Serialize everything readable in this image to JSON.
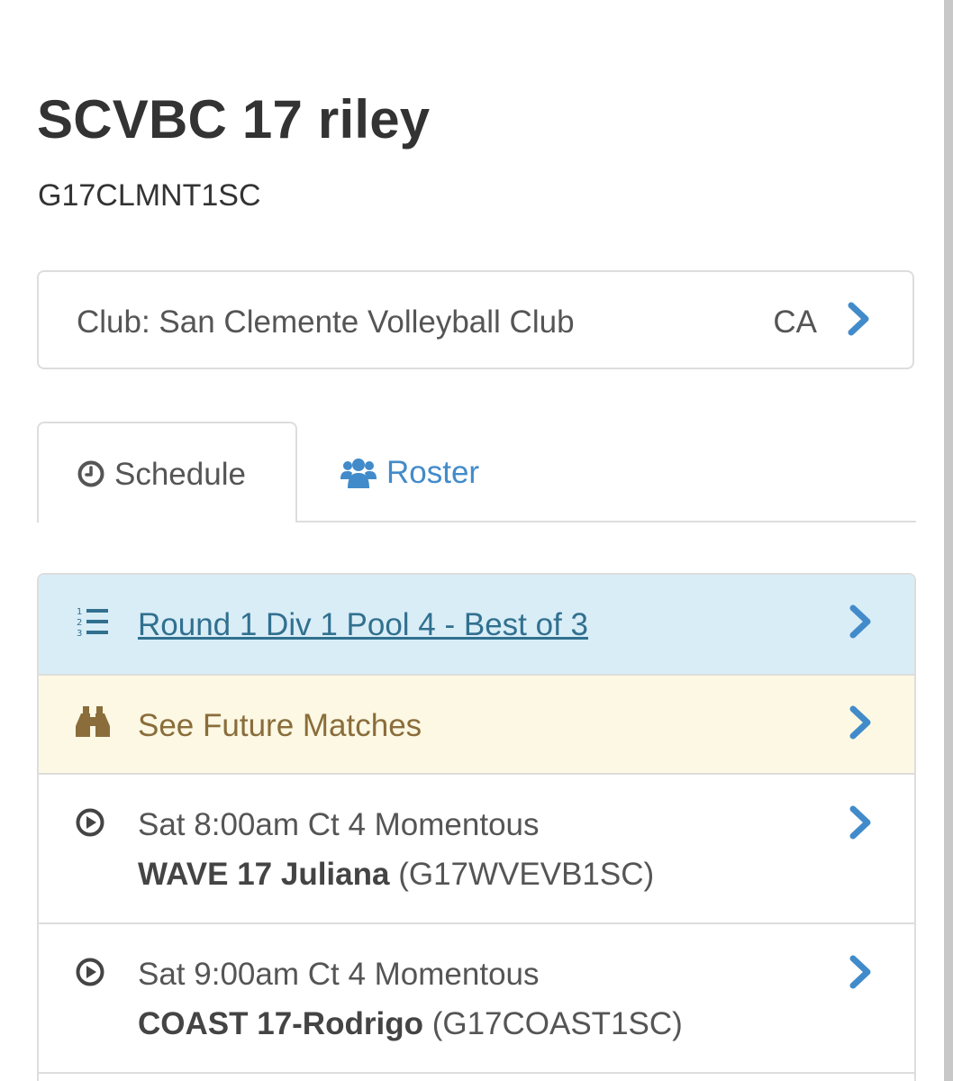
{
  "team": {
    "name": "SCVBC 17 riley",
    "code": "G17CLMNT1SC"
  },
  "club": {
    "label": "Club: San Clemente Volleyball Club",
    "state": "CA"
  },
  "tabs": [
    {
      "label": "Schedule",
      "icon": "clock-icon",
      "active": true
    },
    {
      "label": "Roster",
      "icon": "users-icon",
      "active": false
    }
  ],
  "schedule": {
    "pool": {
      "label": "Round 1 Div 1 Pool 4 - Best of 3",
      "icon": "ordered-list-icon"
    },
    "future": {
      "label": "See Future Matches",
      "icon": "binoculars-icon"
    },
    "matches": [
      {
        "time": "Sat 8:00am Ct 4 Momentous",
        "opponent": "WAVE 17 Juliana",
        "opponent_code": "(G17WVEVB1SC)",
        "icon": "play-circle-icon"
      },
      {
        "time": "Sat 9:00am Ct 4 Momentous",
        "opponent": "COAST 17-Rodrigo",
        "opponent_code": "(G17COAST1SC)",
        "icon": "play-circle-icon"
      }
    ]
  },
  "colors": {
    "link": "#428bca",
    "info_bg": "#d9edf7",
    "info_text": "#31708f",
    "warning_bg": "#fcf8e3",
    "warning_text": "#8a6d3b",
    "border": "#dddddd"
  }
}
